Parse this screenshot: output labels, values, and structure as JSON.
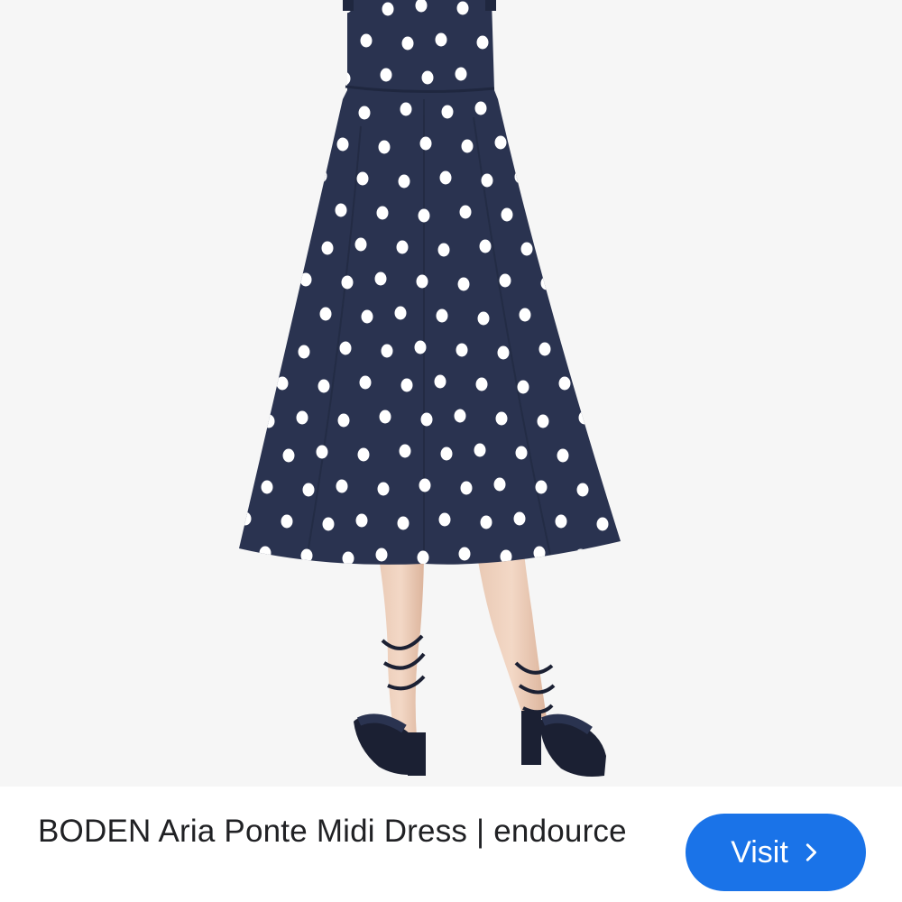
{
  "result": {
    "title": "BODEN Aria Ponte Midi Dress | endource",
    "visit_label": "Visit",
    "visit_icon": "chevron-right-icon"
  },
  "image": {
    "subject": "product-photo",
    "dress_color": "#2a3350",
    "dot_color": "#ffffff",
    "background_color": "#f6f6f6"
  },
  "colors": {
    "accent": "#1a73e8",
    "title_text": "#202124"
  }
}
